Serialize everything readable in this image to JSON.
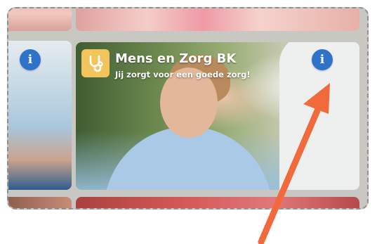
{
  "tile": {
    "title": "Mens en Zorg BK",
    "subtitle": "Jij zorgt voor een goede zorg!",
    "badge_icon": "stethoscope-icon",
    "badge_color": "#f2c45c"
  },
  "info_buttons": {
    "glyph": "i",
    "icon": "info-icon",
    "color": "#2f73c9"
  },
  "annotation": {
    "arrow_color": "#f26a3c",
    "points_to": "info-button-main"
  }
}
